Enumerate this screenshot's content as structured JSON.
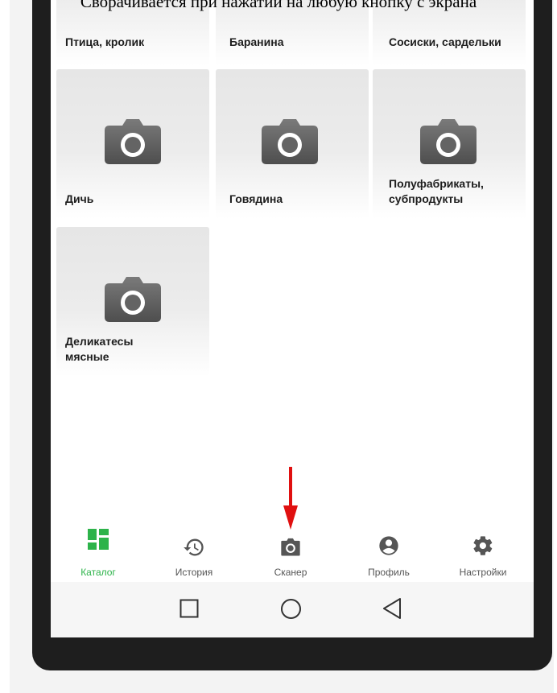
{
  "caption": "Сворачивается при нажатии на любую кнопку с экрана",
  "catalog": {
    "top_row": [
      "Птица, кролик",
      "Баранина",
      "Сосиски, сардельки"
    ],
    "tiles": [
      {
        "label": "Дичь"
      },
      {
        "label": "Говядина"
      },
      {
        "label_line1": "Полуфабрикаты,",
        "label_line2": "субпродукты"
      },
      {
        "label_line1": "Деликатесы",
        "label_line2": "мясные"
      }
    ]
  },
  "bottom_nav": {
    "items": [
      {
        "label": "Каталог",
        "icon": "grid-icon",
        "active": true
      },
      {
        "label": "История",
        "icon": "history-icon",
        "active": false
      },
      {
        "label": "Сканер",
        "icon": "camera-icon",
        "active": false
      },
      {
        "label": "Профиль",
        "icon": "profile-icon",
        "active": false
      },
      {
        "label": "Настройки",
        "icon": "gear-icon",
        "active": false
      }
    ]
  },
  "colors": {
    "accent": "#2db34a",
    "annotation_arrow": "#e01010",
    "icon_gray": "#555555"
  }
}
